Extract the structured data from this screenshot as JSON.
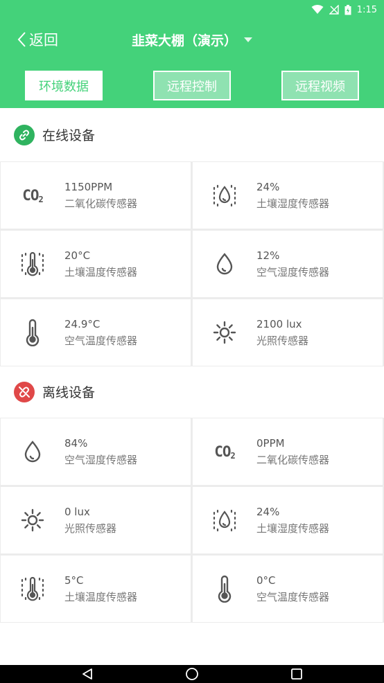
{
  "status_bar": {
    "time": "1:15"
  },
  "header": {
    "back_label": "返回",
    "title": "韭菜大棚（演示）",
    "tabs": [
      {
        "label": "环境数据",
        "active": true
      },
      {
        "label": "远程控制",
        "active": false
      },
      {
        "label": "远程视频",
        "active": false
      }
    ]
  },
  "online": {
    "title": "在线设备",
    "sensors": [
      {
        "icon": "co2-icon",
        "value": "1150PPM",
        "label": "二氧化碳传感器"
      },
      {
        "icon": "soil-moisture-icon",
        "value": "24%",
        "label": "土壤湿度传感器"
      },
      {
        "icon": "soil-temperature-icon",
        "value": "20°C",
        "label": "土壤温度传感器"
      },
      {
        "icon": "air-humidity-icon",
        "value": "12%",
        "label": "空气湿度传感器"
      },
      {
        "icon": "thermometer-icon",
        "value": "24.9°C",
        "label": "空气温度传感器"
      },
      {
        "icon": "sun-icon",
        "value": "2100 lux",
        "label": "光照传感器"
      }
    ]
  },
  "offline": {
    "title": "离线设备",
    "sensors": [
      {
        "icon": "air-humidity-icon",
        "value": "84%",
        "label": "空气湿度传感器"
      },
      {
        "icon": "co2-icon",
        "value": "0PPM",
        "label": "二氧化碳传感器"
      },
      {
        "icon": "sun-icon",
        "value": "0 lux",
        "label": "光照传感器"
      },
      {
        "icon": "soil-moisture-icon",
        "value": "24%",
        "label": "土壤湿度传感器"
      },
      {
        "icon": "soil-temperature-icon",
        "value": "5°C",
        "label": "土壤温度传感器"
      },
      {
        "icon": "thermometer-icon",
        "value": "0°C",
        "label": "空气温度传感器"
      }
    ]
  },
  "colors": {
    "brand": "#44d27a",
    "online": "#2fb35f",
    "offline": "#e04848"
  }
}
